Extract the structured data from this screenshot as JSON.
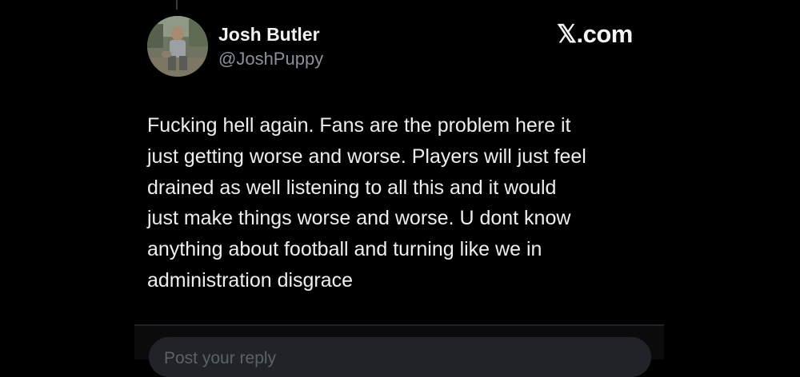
{
  "author": {
    "name": "Josh Butler",
    "handle": "@JoshPuppy",
    "avatar_icon": "profile-photo"
  },
  "source": {
    "logo_text": "𝕏.com"
  },
  "tweet": {
    "lines": [
      "Fucking hell again. Fans are the problem here it",
      "just getting worse and worse. Players will just feel",
      "drained as well listening to all this and it would",
      "just make things worse and worse. U dont know",
      "anything about football and turning like we in",
      "administration disgrace"
    ]
  },
  "reply": {
    "placeholder": "Post your reply"
  },
  "colors": {
    "background": "#000000",
    "text": "#e7e9ea",
    "secondary_text": "#8b9198",
    "reply_box": "#202327"
  }
}
